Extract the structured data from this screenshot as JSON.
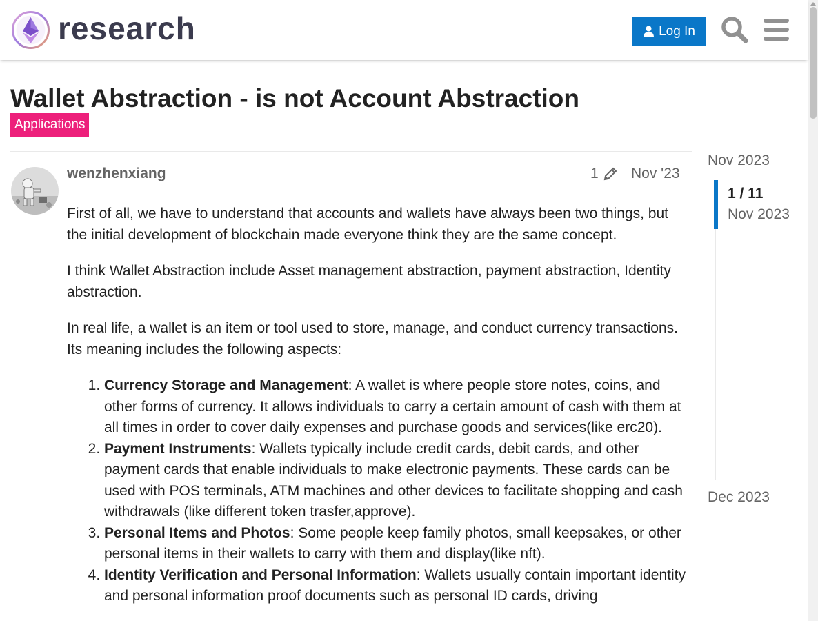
{
  "header": {
    "site_name": "research",
    "login_label": "Log In"
  },
  "topic": {
    "title": "Wallet Abstraction - is not Account Abstraction",
    "category": "Applications",
    "category_color": "#ed207b"
  },
  "post": {
    "username": "wenzhenxiang",
    "edit_count": "1",
    "date": "Nov '23",
    "paragraphs": [
      "First of all, we have to understand that accounts and wallets have always been two things, but the initial development of blockchain made everyone think they are the same concept.",
      "I think Wallet Abstraction include Asset management abstraction, payment abstraction, Identity abstraction.",
      "In real life, a wallet is an item or tool used to store, manage, and conduct currency transactions. Its meaning includes the following aspects:"
    ],
    "list": [
      {
        "term": "Currency Storage and Management",
        "text": ": A wallet is where people store notes, coins, and other forms of currency. It allows individuals to carry a certain amount of cash with them at all times in order to cover daily expenses and purchase goods and services(like erc20)."
      },
      {
        "term": "Payment Instruments",
        "text": ": Wallets typically include credit cards, debit cards, and other payment cards that enable individuals to make electronic payments. These cards can be used with POS terminals, ATM machines and other devices to facilitate shopping and cash withdrawals (like different token trasfer,approve)."
      },
      {
        "term": "Personal Items and Photos",
        "text": ": Some people keep family photos, small keepsakes, or other personal items in their wallets to carry with them and display(like nft)."
      },
      {
        "term": "Identity Verification and Personal Information",
        "text": ": Wallets usually contain important identity and personal information proof documents such as personal ID cards, driving"
      }
    ]
  },
  "timeline": {
    "start_label": "Nov 2023",
    "position": "1 / 11",
    "position_date": "Nov 2023",
    "end_label": "Dec 2023"
  },
  "colors": {
    "accent": "#0a77c8",
    "muted_text": "#646464"
  },
  "icons": [
    "logo-icon",
    "user-icon",
    "search-icon",
    "hamburger-menu-icon",
    "pencil-icon"
  ]
}
